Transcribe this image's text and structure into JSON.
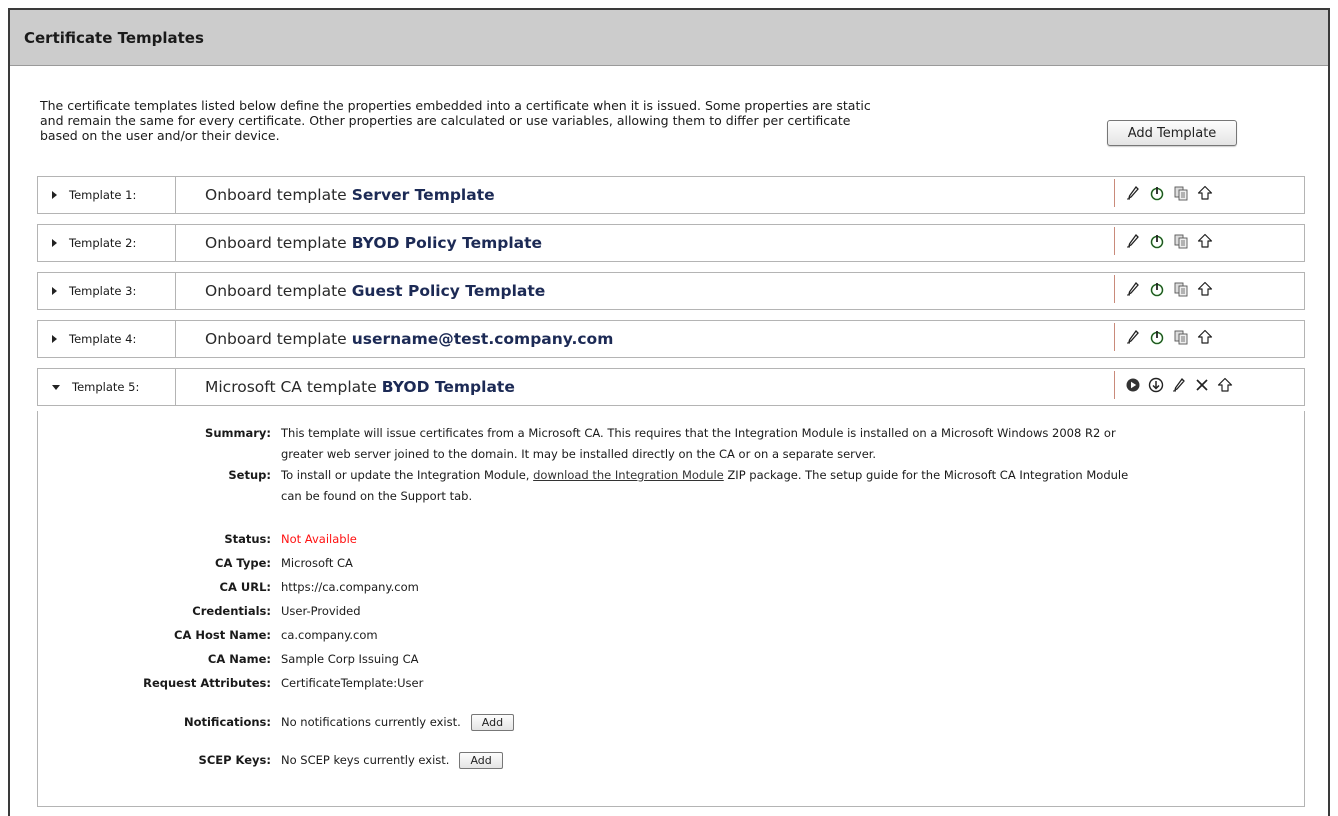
{
  "panel": {
    "title": "Certificate Templates"
  },
  "intro": {
    "line1": "The certificate templates listed below define the properties embedded into a certificate when it is issued. Some properties are static",
    "line2": "and remain the same for every certificate. Other properties are calculated or use variables, allowing them to differ per certificate",
    "line3": "based on the user and/or their device.",
    "add_button": "Add Template"
  },
  "templates": [
    {
      "label": "Template 1:",
      "prefix": "Onboard template",
      "name": "Server Template",
      "expanded": false
    },
    {
      "label": "Template 2:",
      "prefix": "Onboard template",
      "name": "BYOD Policy Template",
      "expanded": false
    },
    {
      "label": "Template 3:",
      "prefix": "Onboard template",
      "name": "Guest Policy Template",
      "expanded": false
    },
    {
      "label": "Template 4:",
      "prefix": "Onboard template",
      "name": "username@test.company.com",
      "expanded": false
    },
    {
      "label": "Template 5:",
      "prefix": "Microsoft CA template",
      "name": "BYOD Template",
      "expanded": true
    }
  ],
  "icons": {
    "collapsed_row": [
      "edit-icon",
      "power-icon",
      "copy-icon",
      "move-up-icon"
    ],
    "expanded_row": [
      "play-icon",
      "download-icon",
      "edit-icon",
      "delete-icon",
      "move-up-icon"
    ],
    "power_color": "#2e9e2e"
  },
  "details": {
    "summary_label": "Summary:",
    "summary_line1": "This template will issue certificates from a Microsoft CA. This requires that the Integration Module is installed on a Microsoft Windows 2008 R2 or",
    "summary_line2": "greater web server joined to the domain. It may be installed directly on the CA or on a separate server.",
    "setup_label": "Setup:",
    "setup_before": "To install or update the Integration Module, ",
    "setup_link": "download the Integration Module",
    "setup_after": " ZIP package. The setup guide for the Microsoft CA Integration Module",
    "setup_line2": "can be found on the Support tab.",
    "status_label": "Status:",
    "status_value": "Not Available",
    "status_color": "#ff1111",
    "catype_label": "CA Type:",
    "catype_value": "Microsoft CA",
    "caurl_label": "CA URL:",
    "caurl_value": "https://ca.company.com",
    "cred_label": "Credentials:",
    "cred_value": "User-Provided",
    "host_label": "CA Host Name:",
    "host_value": "ca.company.com",
    "caname_label": "CA Name:",
    "caname_value": "Sample Corp Issuing CA",
    "req_label": "Request Attributes:",
    "req_value": "CertificateTemplate:User",
    "notif_label": "Notifications:",
    "notif_value": "No notifications currently exist.",
    "notif_button": "Add",
    "scep_label": "SCEP Keys:",
    "scep_value": "No SCEP keys currently exist.",
    "scep_button": "Add"
  }
}
